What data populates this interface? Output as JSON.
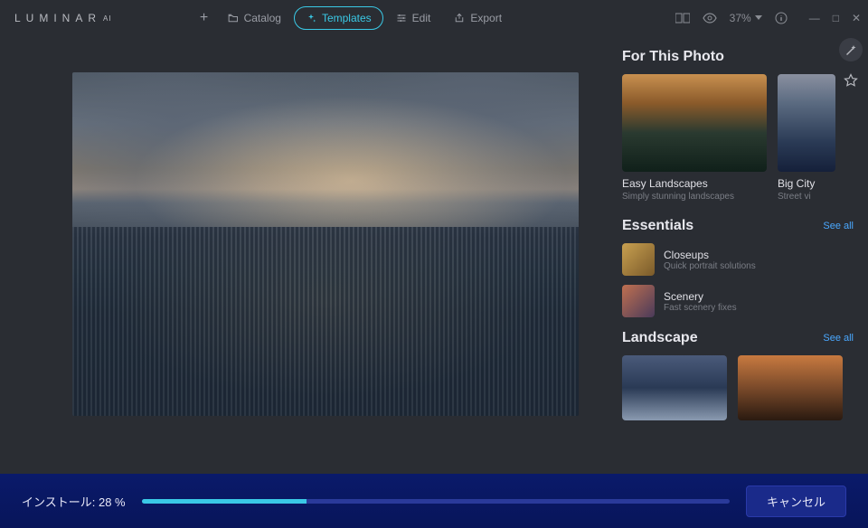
{
  "app": {
    "name": "LUMINAR",
    "suffix": "AI"
  },
  "nav": {
    "catalog": "Catalog",
    "templates": "Templates",
    "edit": "Edit",
    "export": "Export"
  },
  "tools": {
    "zoom": "37%"
  },
  "panel": {
    "for_this_photo": "For This Photo",
    "easy_landscapes": {
      "title": "Easy Landscapes",
      "sub": "Simply stunning landscapes"
    },
    "big_city": {
      "title": "Big City",
      "sub": "Street vi"
    },
    "essentials_title": "Essentials",
    "see_all": "See all",
    "closeups": {
      "title": "Closeups",
      "sub": "Quick portrait solutions"
    },
    "scenery": {
      "title": "Scenery",
      "sub": "Fast scenery fixes"
    },
    "landscape_title": "Landscape"
  },
  "install": {
    "label_prefix": "インストール: ",
    "percent_text": "28 %",
    "percent_value": 28,
    "cancel": "キャンセル"
  }
}
